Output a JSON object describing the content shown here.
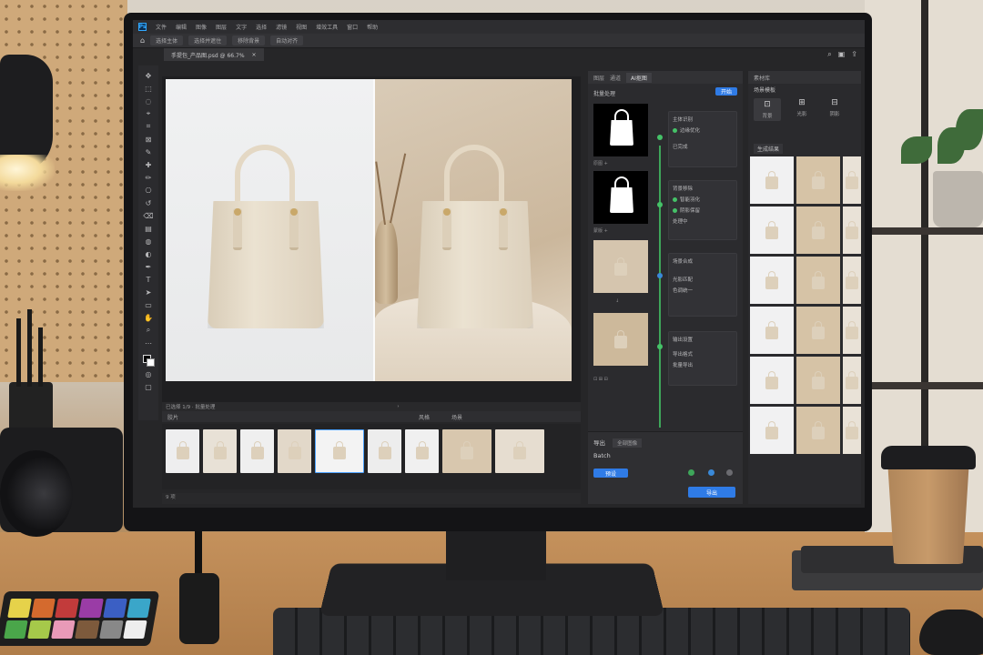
{
  "app": {
    "logo_text": "Ps",
    "menu": [
      "文件",
      "编辑",
      "图像",
      "图层",
      "文字",
      "选择",
      "滤镜",
      "视图",
      "增效工具",
      "窗口",
      "帮助"
    ],
    "options": [
      "选择主体",
      "选择并遮住",
      "移除背景",
      "自动对齐"
    ],
    "document_tab": "手提包_产品图.psd @ 66.7%",
    "tab_close": "×"
  },
  "icons": {
    "home": "home-icon",
    "search": "search-icon",
    "workspace": "workspace-icon",
    "share": "share-icon"
  },
  "flow_panel": {
    "tabs": [
      "图层",
      "通道",
      "AI抠图"
    ],
    "active_tab": "AI抠图",
    "subtitle": "批量处理",
    "run_label": "开始",
    "nodes": [
      {
        "title": "主体识别",
        "check": "边缘优化",
        "status": "已完成"
      },
      {
        "title": "背景移除",
        "check1": "智能羽化",
        "check2": "阴影保留",
        "status": "处理中"
      },
      {
        "title": "场景合成",
        "line1": "光影匹配",
        "line2": "色调统一"
      },
      {
        "title": "输出设置",
        "line1": "导出格式",
        "line2": "批量导出"
      }
    ],
    "node_labels": [
      "原图 +",
      "蒙版 +",
      "合成 +"
    ],
    "thumb_toolbar": "⊡ ⊞ ⊟",
    "footer": {
      "row1_label": "导出",
      "row1_chip": "全部图像",
      "row2_label": "Batch",
      "preset_button": "预设",
      "export_button": "导出"
    }
  },
  "assets_panel": {
    "title": "素材库",
    "subtitle_text": "场景模板",
    "tools": [
      {
        "icon": "⊡",
        "label": "背景"
      },
      {
        "icon": "⊞",
        "label": "光影"
      },
      {
        "icon": "⊟",
        "label": "阴影"
      }
    ],
    "section": "生成结果",
    "rows": 6
  },
  "filmstrip": {
    "header_left": "胶片",
    "header_mid": "风格",
    "header_right": "场景",
    "bar_text": "已选择 1/9 · 批量处理",
    "bar_arrow": "›",
    "foot_text": "9 项",
    "selected_index": 4
  },
  "colors": {
    "accent": "#2f7be6",
    "flow_green": "#45c268",
    "ui_dark": "#262628"
  }
}
